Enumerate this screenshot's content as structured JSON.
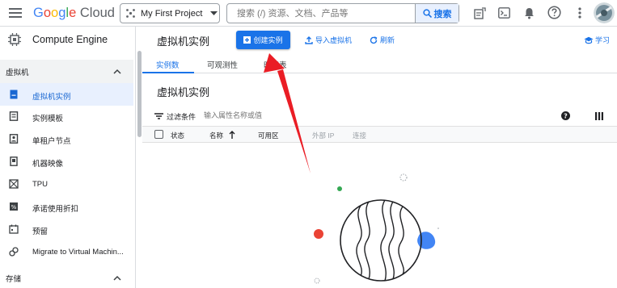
{
  "topbar": {
    "logo_google_letters": [
      "G",
      "o",
      "o",
      "g",
      "l",
      "e"
    ],
    "logo_cloud": "Cloud",
    "project_name": "My First Project",
    "search_placeholder": "搜索 (/) 资源、文档、产品等",
    "search_button": "搜索"
  },
  "sidebar": {
    "title": "Compute Engine",
    "section_vm": "虚拟机",
    "items": [
      {
        "label": "虚拟机实例",
        "icon": "vm-instance-icon"
      },
      {
        "label": "实例模板",
        "icon": "instance-template-icon"
      },
      {
        "label": "单租户节点",
        "icon": "sole-tenant-node-icon"
      },
      {
        "label": "机器映像",
        "icon": "machine-image-icon"
      },
      {
        "label": "TPU",
        "icon": "tpu-icon"
      },
      {
        "label": "承诺使用折扣",
        "icon": "discount-icon"
      },
      {
        "label": "预留",
        "icon": "reservation-icon"
      },
      {
        "label": "Migrate to Virtual Machin...",
        "icon": "migrate-icon"
      }
    ],
    "section_storage": "存储"
  },
  "main": {
    "page_title": "虚拟机实例",
    "create_button": "创建实例",
    "import_button": "导入虚拟机",
    "refresh_button": "刷新",
    "learn_button": "学习",
    "tabs": [
      "实例数",
      "可观测性",
      "时间表"
    ],
    "section_title": "虚拟机实例",
    "filter_label": "过滤条件",
    "filter_placeholder": "输入属性名称或值",
    "columns": [
      "状态",
      "名称",
      "可用区",
      "外部 IP",
      "连接"
    ]
  },
  "colors": {
    "accent": "#1a73e8",
    "arrow": "#ea1d25",
    "dot_red": "#ea4335",
    "dot_green": "#34a853",
    "dot_blue": "#4285f4"
  }
}
